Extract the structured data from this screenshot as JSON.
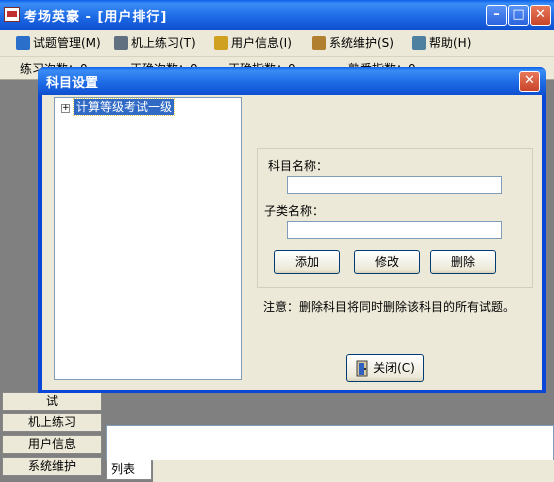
{
  "window": {
    "title": "考场英豪 - [用户排行]"
  },
  "menu": [
    {
      "label": "试题管理(M)",
      "icon": "book-icon",
      "color": "#2a6fc9"
    },
    {
      "label": "机上练习(T)",
      "icon": "computer-icon",
      "color": "#607080"
    },
    {
      "label": "用户信息(I)",
      "icon": "document-icon",
      "color": "#d0a020"
    },
    {
      "label": "系统维护(S)",
      "icon": "tools-icon",
      "color": "#b08030"
    },
    {
      "label": "帮助(H)",
      "icon": "help-book-icon",
      "color": "#5080a0"
    }
  ],
  "status": [
    "练习次数：0",
    "正确次数：0",
    "正确指数：0",
    "熟悉指数：0"
  ],
  "nav": [
    "试",
    "机上练习",
    "用户信息",
    "系统维护"
  ],
  "list_tab": "列表",
  "dialog": {
    "title": "科目设置",
    "tree_root": "计算等级考试一级",
    "subject_label": "科目名称：",
    "subject_value": "",
    "subclass_label": "子类名称：",
    "subclass_value": "",
    "add_label": "添加",
    "edit_label": "修改",
    "delete_label": "删除",
    "note": "注意：删除科目将同时删除该科目的所有试题。",
    "close_label": "关闭(C)"
  }
}
